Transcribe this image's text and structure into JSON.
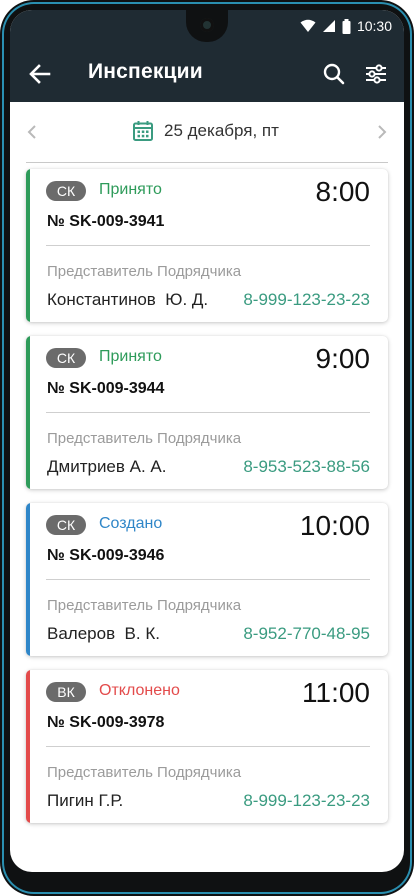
{
  "status_bar": {
    "time": "10:30"
  },
  "app_bar": {
    "title": "Инспекции",
    "back_icon": "arrow-left-icon",
    "search_icon": "search-icon",
    "filter_icon": "tune-icon"
  },
  "date_bar": {
    "date": "25 декабря, пт",
    "icon": "calendar-icon"
  },
  "colors": {
    "accepted": "#2e9b5a",
    "created": "#2f86c8",
    "rejected": "#e34b4b",
    "phone": "#3a9b80",
    "header": "#1f2b33"
  },
  "inspections": [
    {
      "type": "СК",
      "status": "Принято",
      "status_kind": "accepted",
      "time": "8:00",
      "number": "№ SK-009-3941",
      "rep_label": "Представитель Подрядчика",
      "rep_name": "Константинов  Ю. Д.",
      "phone": "8-999-123-23-23"
    },
    {
      "type": "СК",
      "status": "Принято",
      "status_kind": "accepted",
      "time": "9:00",
      "number": "№ SK-009-3944",
      "rep_label": "Представитель Подрядчика",
      "rep_name": "Дмитриев А. А.",
      "phone": "8-953-523-88-56"
    },
    {
      "type": "СК",
      "status": "Создано",
      "status_kind": "created",
      "time": "10:00",
      "number": "№ SK-009-3946",
      "rep_label": "Представитель Подрядчика",
      "rep_name": "Валеров  В. К.",
      "phone": "8-952-770-48-95"
    },
    {
      "type": "ВК",
      "status": "Отклонено",
      "status_kind": "rejected",
      "time": "11:00",
      "number": "№ SK-009-3978",
      "rep_label": "Представитель Подрядчика",
      "rep_name": "Пигин Г.Р.",
      "phone": "8-999-123-23-23"
    }
  ]
}
